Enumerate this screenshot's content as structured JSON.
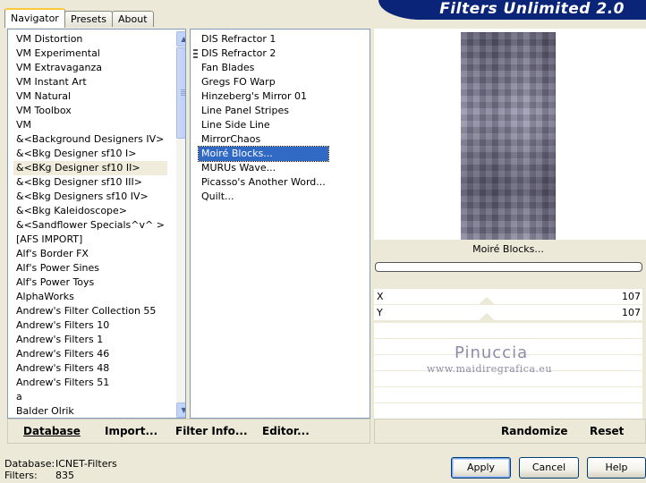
{
  "tabs": [
    {
      "label": "Navigator",
      "active": true
    },
    {
      "label": "Presets",
      "active": false
    },
    {
      "label": "About",
      "active": false
    }
  ],
  "banner": {
    "title": "Filters Unlimited 2.0"
  },
  "categories": [
    "VM Distortion",
    "VM Experimental",
    "VM Extravaganza",
    "VM Instant Art",
    "VM Natural",
    "VM Toolbox",
    "VM",
    "&<Background Designers IV>",
    "&<Bkg Designer sf10 I>",
    "&<BKg Designer sf10 II>",
    "&<Bkg Designer sf10 III>",
    "&<Bkg Designers sf10 IV>",
    "&<Bkg Kaleidoscope>",
    "&<Sandflower Specials^v^ >",
    "[AFS IMPORT]",
    "Alf's Border FX",
    "Alf's Power Sines",
    "Alf's Power Toys",
    "AlphaWorks",
    "Andrew's Filter Collection 55",
    "Andrew's Filters 10",
    "Andrew's Filters 1",
    "Andrew's Filters 46",
    "Andrew's Filters 48",
    "Andrew's Filters 51",
    "a",
    "Balder Olrik"
  ],
  "selected_category": "&<BKg Designer sf10 II>",
  "filters": [
    "DIS Refractor 1",
    "DIS Refractor 2",
    "Fan Blades",
    "Gregs FO Warp",
    "Hinzeberg's Mirror 01",
    "Line Panel Stripes",
    "Line Side Line",
    "MirrorChaos",
    "Moiré Blocks...",
    "MURUs Wave...",
    "Picasso's Another Word...",
    "Quilt..."
  ],
  "selected_filter": "Moiré Blocks...",
  "preview": {
    "filter_name": "Moiré Blocks..."
  },
  "params": [
    {
      "label": "X",
      "value": "107"
    },
    {
      "label": "Y",
      "value": "107"
    }
  ],
  "watermark": {
    "name": "Pinuccia",
    "site": "www.maidiregrafica.eu"
  },
  "toolbar": {
    "database": "Database",
    "import": "Import...",
    "filter_info": "Filter Info...",
    "editor": "Editor...",
    "randomize": "Randomize",
    "reset": "Reset"
  },
  "status": {
    "database_label": "Database:",
    "database_value": "ICNET-Filters",
    "filters_label": "Filters:",
    "filters_value": "835"
  },
  "buttons": {
    "apply": "Apply",
    "cancel": "Cancel",
    "help": "Help"
  },
  "colors": {
    "selection": "#316ac5",
    "banner": "#0a2478",
    "face": "#ece9d8"
  }
}
